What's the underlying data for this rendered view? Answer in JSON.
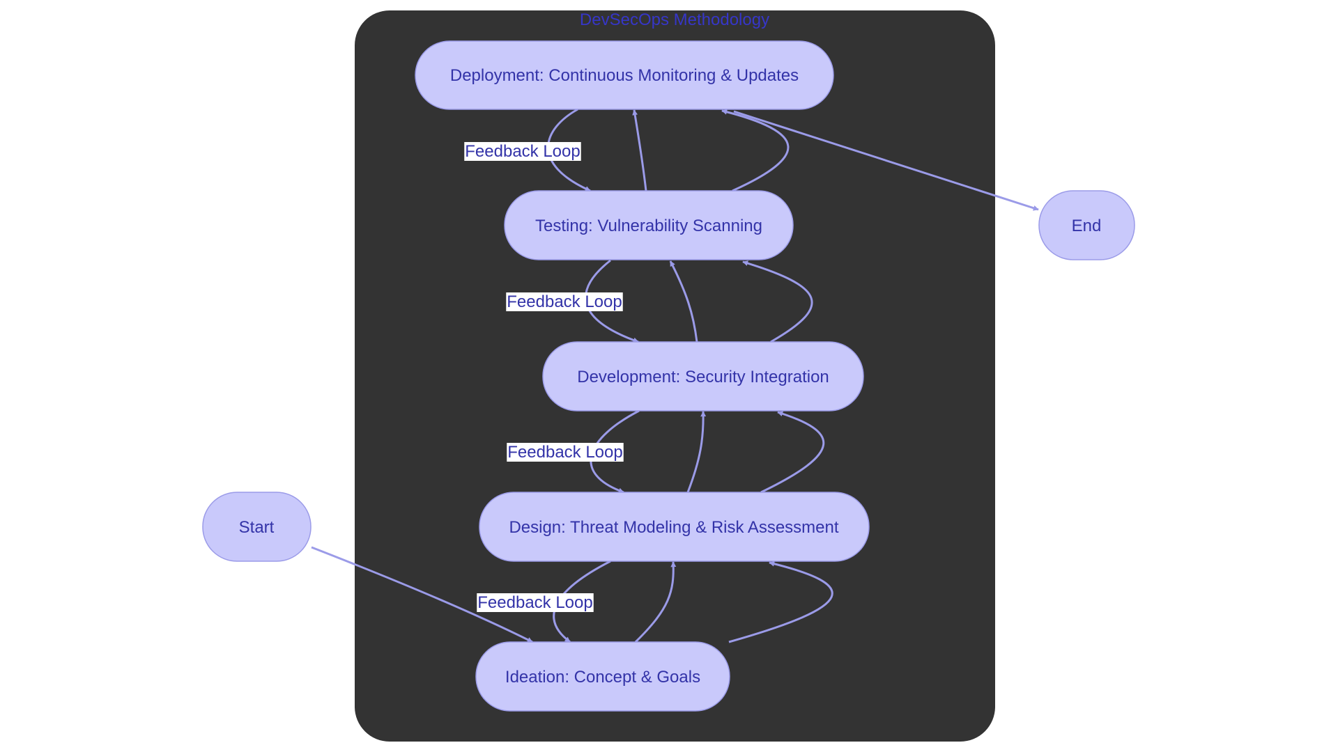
{
  "diagram": {
    "title": "DevSecOps Methodology",
    "colors": {
      "cluster_fill": "#333333",
      "node_fill": "#c9c9fb",
      "node_stroke": "#9b9be8",
      "node_text": "#3333a8",
      "title_text": "#3636c8",
      "edge": "#9b9be8",
      "edge_label_bg": "#ffffff"
    },
    "nodes": {
      "start": "Start",
      "end": "End",
      "ideation": "Ideation: Concept & Goals",
      "design": "Design: Threat Modeling & Risk Assessment",
      "development": "Development: Security Integration",
      "testing": "Testing: Vulnerability Scanning",
      "deployment": "Deployment: Continuous Monitoring & Updates"
    },
    "edge_labels": {
      "deployment_testing": "Feedback Loop",
      "testing_development": "Feedback Loop",
      "development_design": "Feedback Loop",
      "design_ideation": "Feedback Loop"
    },
    "edges": [
      {
        "from": "Start",
        "to": "Ideation"
      },
      {
        "from": "Ideation",
        "to": "Design"
      },
      {
        "from": "Ideation",
        "to": "Design"
      },
      {
        "from": "Design",
        "to": "Ideation",
        "label": "Feedback Loop"
      },
      {
        "from": "Design",
        "to": "Development"
      },
      {
        "from": "Design",
        "to": "Development"
      },
      {
        "from": "Development",
        "to": "Design",
        "label": "Feedback Loop"
      },
      {
        "from": "Development",
        "to": "Testing"
      },
      {
        "from": "Development",
        "to": "Testing"
      },
      {
        "from": "Testing",
        "to": "Development",
        "label": "Feedback Loop"
      },
      {
        "from": "Testing",
        "to": "Deployment"
      },
      {
        "from": "Testing",
        "to": "Deployment"
      },
      {
        "from": "Deployment",
        "to": "Testing",
        "label": "Feedback Loop"
      },
      {
        "from": "Deployment",
        "to": "End"
      }
    ]
  }
}
